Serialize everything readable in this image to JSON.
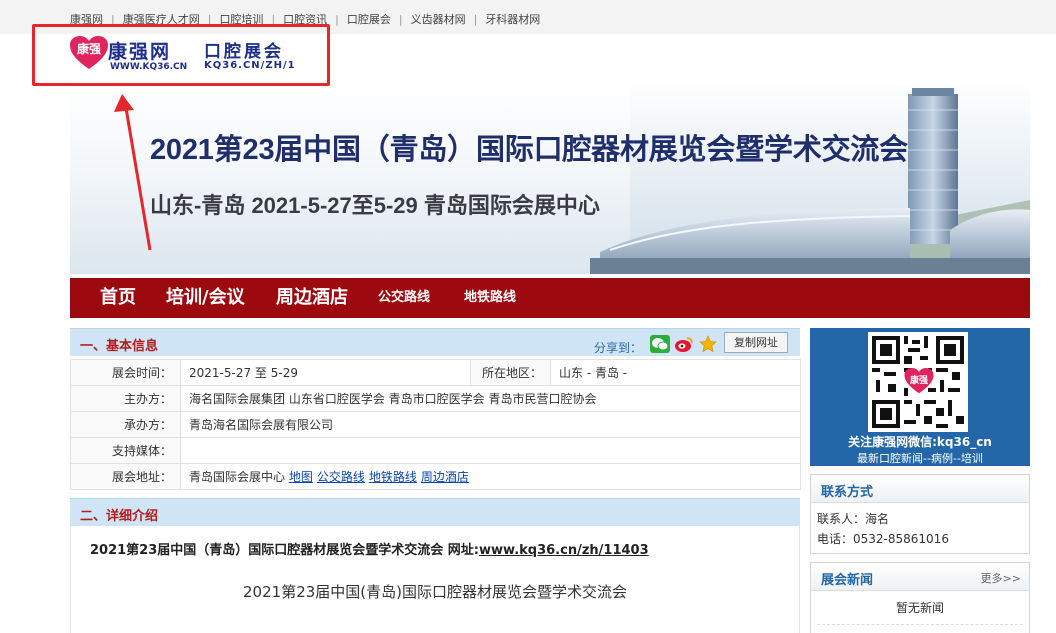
{
  "topbar": {
    "links": [
      "康强网",
      "康强医疗人才网",
      "口腔培训",
      "口腔资讯",
      "口腔展会",
      "义齿器材网",
      "牙科器材网"
    ],
    "separator": "|"
  },
  "logo": {
    "heart_text": "康强",
    "name": "康强网",
    "url": "WWW.KQ36.CN",
    "sub_name": "口腔展会",
    "sub_url": "KQ36.CN/ZH/1"
  },
  "banner": {
    "title": "2021第23届中国（青岛）国际口腔器材展览会暨学术交流会",
    "subtitle": "山东-青岛  2021-5-27至5-29  青岛国际会展中心"
  },
  "nav": {
    "items": [
      "首页",
      "培训/会议",
      "周边酒店",
      "公交路线",
      "地铁路线"
    ]
  },
  "basic_info": {
    "section_title": "一、基本信息",
    "share_label": "分享到：",
    "copy_label": "复制网址",
    "time_label": "展会时间：",
    "time_value": "2021-5-27 至 5-29",
    "region_label": "所在地区：",
    "region_value": "山东 - 青岛 -",
    "host_label": "主办方：",
    "host_value": "海名国际会展集团 山东省口腔医学会 青岛市口腔医学会 青岛市民营口腔协会",
    "organizer_label": "承办方：",
    "organizer_value": "青岛海名国际会展有限公司",
    "media_label": "支持媒体：",
    "media_value": "",
    "address_label": "展会地址：",
    "address_value": "青岛国际会展中心",
    "address_links": [
      "地图",
      "公交路线",
      "地铁路线",
      "周边酒店"
    ]
  },
  "detail": {
    "section_title": "二、详细介绍",
    "line_prefix": "2021第23届中国（青岛）国际口腔器材展览会暨学术交流会 网址:",
    "line_url": "www.kq36.cn/zh/11403",
    "center_title": "2021第23届中国(青岛)国际口腔器材展览会暨学术交流会"
  },
  "qr": {
    "badge": "康强",
    "text1": "关注康强网微信:kq36_cn",
    "text2": "最新口腔新闻--病例--培训"
  },
  "contact": {
    "title": "联系方式",
    "person": "联系人：海名",
    "phone": "电话：0532-85861016"
  },
  "news": {
    "title": "展会新闻",
    "more": "更多>>",
    "empty": "暂无新闻"
  },
  "colors": {
    "nav_bg": "#9c0a10",
    "section_bg": "#cfe4f4",
    "section_title": "#b51c1c",
    "panel_title": "#2467a8",
    "highlight": "#e5262a"
  }
}
